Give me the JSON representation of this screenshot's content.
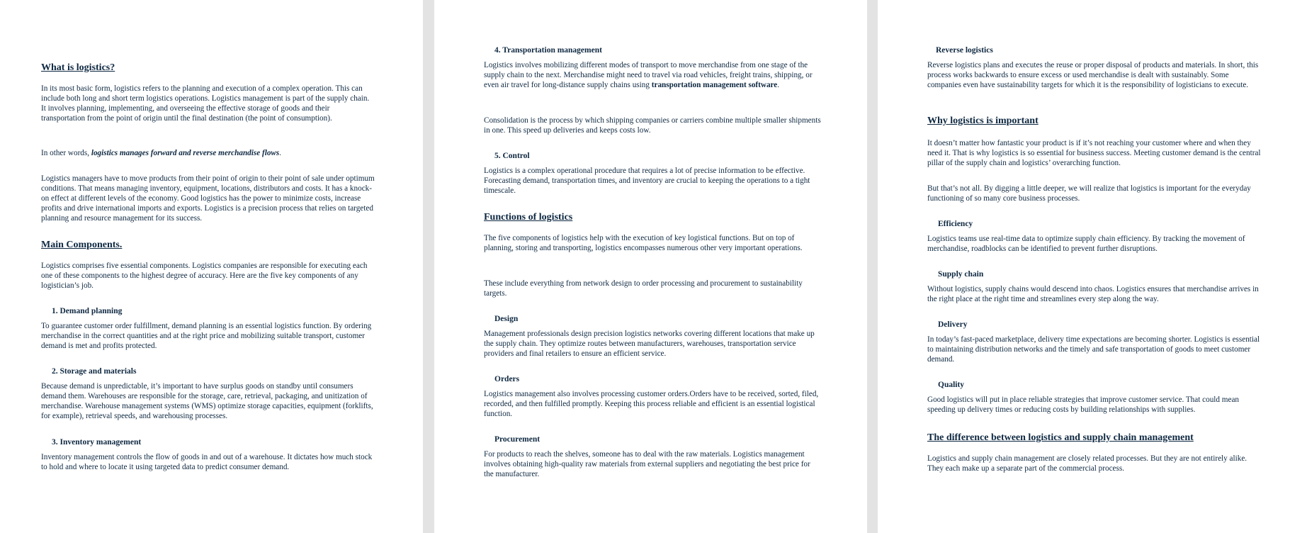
{
  "page1": {
    "what_heading": "What is logistics?",
    "what_p1": "In its most basic form, logistics refers to the planning and execution of a complex operation. This can include both long and short term logistics operations. Logistics management is part of the supply chain. It involves planning, implementing, and overseeing the effective storage of goods and their transportation from the point of origin until the final destination (the point of consumption).",
    "what_p2_prefix": "In other words, ",
    "what_p2_emphasis": "logistics manages forward and reverse merchandise flows",
    "what_p2_suffix": ".",
    "what_p3": "Logistics managers have to move products from their point of origin to their point of sale under optimum conditions. That means managing inventory, equipment, locations, distributors and costs. It has a knock-on effect at different levels of the economy. Good logistics has the power to minimize costs, increase profits and drive international imports and exports. Logistics is a precision process that relies on targeted planning and resource management for its success.",
    "main_heading": "Main Components.",
    "main_p1": "Logistics comprises five essential components. Logistics companies are responsible for executing each one of these components to the highest degree of accuracy. Here are the five key components of any logistician’s job.",
    "demand_heading": "1.  Demand planning",
    "demand_p": "To guarantee customer order fulfillment, demand planning is an essential logistics function. By ordering merchandise in the correct quantities and at the right price and mobilizing suitable transport, customer demand is met and profits protected.",
    "storage_heading": "2.  Storage and materials",
    "storage_p": "Because demand is unpredictable, it’s important to have surplus goods on standby until consumers demand them. Warehouses are responsible for the storage, care, retrieval, packaging, and unitization of merchandise. Warehouse management systems (WMS) optimize storage capacities, equipment (forklifts, for example), retrieval speeds, and warehousing processes.",
    "inventory_heading": "3.  Inventory management",
    "inventory_p": "Inventory management controls the flow of goods in and out of a warehouse. It dictates how much stock to hold and where to locate it using targeted data to predict consumer demand."
  },
  "page2": {
    "transport_heading": "4.  Transportation management",
    "transport_p_prefix": "Logistics involves mobilizing different modes of transport to move merchandise from one stage of the supply chain to the next. Merchandise might need to travel via road vehicles, freight trains, shipping, or even air travel for long-distance supply chains using ",
    "transport_p_bold": "transportation management software",
    "transport_p_suffix": ".",
    "consolidation_p": "Consolidation is the process by which shipping companies or carriers combine multiple smaller shipments in one. This speed up deliveries and keeps costs low.",
    "control_heading": "5.  Control",
    "control_p": "Logistics is a complex operational procedure that requires a lot of precise information to be effective. Forecasting demand, transportation times, and inventory are crucial to keeping the operations to a tight timescale.",
    "functions_heading": "Functions of logistics",
    "functions_p1": "The five components of logistics help with the execution of key logistical functions. But on top of planning, storing and transporting, logistics encompasses numerous other very important operations.",
    "functions_p2": "These include everything from network design to order processing and procurement to sustainability targets.",
    "design_heading": "Design",
    "design_p": "Management professionals design precision logistics networks covering different locations that make up the supply chain. They optimize routes between manufacturers, warehouses, transportation service providers and final retailers to ensure an efficient service.",
    "orders_heading": "Orders",
    "orders_p": "Logistics management also involves processing customer orders.Orders have to be received, sorted, filed, recorded, and then fulfilled promptly. Keeping this process reliable and efficient is an essential logistical function.",
    "procurement_heading": "Procurement",
    "procurement_p": "For products to reach the shelves, someone has to deal with the raw materials. Logistics management involves obtaining high-quality raw materials from external suppliers and negotiating the best price for the manufacturer."
  },
  "page3": {
    "reverse_heading": "Reverse logistics",
    "reverse_p": "Reverse logistics plans and executes the reuse or proper disposal of products and materials. In short, this process works backwards to ensure excess or used merchandise is dealt with sustainably. Some companies even have sustainability targets for which it is the responsibility of logisticians to execute.",
    "why_heading": "Why logistics is important",
    "why_p1": "It doesn’t matter how fantastic your product is if it’s not reaching your customer where and when they need it. That is why logistics is so essential for business success. Meeting customer demand is the central pillar of the supply chain and logistics’ overarching function.",
    "why_p2": "But that’s not all. By digging a little deeper, we will realize that logistics is important for the everyday functioning of so many core business processes.",
    "efficiency_heading": "Efficiency",
    "efficiency_p": "Logistics teams use real-time data to optimize supply chain efficiency. By tracking the movement of merchandise, roadblocks can be identified to prevent further disruptions.",
    "supply_heading": "Supply chain",
    "supply_p": "Without logistics, supply chains would descend into chaos. Logistics ensures that merchandise arrives in the right place at the right time and streamlines every step along the way.",
    "delivery_heading": "Delivery",
    "delivery_p": "In today’s fast-paced marketplace, delivery time expectations are becoming shorter. Logistics is essential to maintaining distribution networks and the timely and safe transportation of goods to meet customer demand.",
    "quality_heading": "Quality",
    "quality_p": "Good logistics will put in place reliable strategies that improve customer service. That could mean speeding up delivery times or reducing costs by building relationships with supplies.",
    "difference_heading": "The difference between logistics and supply chain management",
    "difference_p": "Logistics and supply chain management are closely related processes. But they are not entirely alike. They each make up a separate part of the commercial process."
  }
}
